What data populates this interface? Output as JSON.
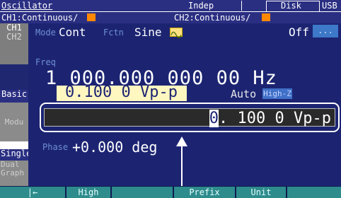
{
  "status": {
    "title": "Oscillator",
    "mode_tag": "Indep",
    "disk": "Disk",
    "usb": "USB",
    "ch1_status": "CH1:Continuous/",
    "ch2_status": "CH2:Continuous/",
    "status_color": "#ff8800"
  },
  "tabs": {
    "ch_active": "CH1",
    "ch_inactive": "CH2",
    "basic": "Basic",
    "modu": "Modu",
    "single": "Single",
    "dual_graph": [
      "Dual",
      "Graph"
    ]
  },
  "params": {
    "mode_label": "Mode",
    "mode_value": "Cont",
    "fctn_label": "Fctn",
    "fctn_value": "Sine",
    "waveform_icon": "sine-wave-icon",
    "output": "Off",
    "more": "...",
    "freq_label": "Freq",
    "freq_value": "1 000.000 000 00 Hz",
    "amp_value": "0.100 0 Vp-p",
    "auto_label": "Auto",
    "load_badge": "High-Z",
    "phase_label": "Phase",
    "phase_value": "+0.000 deg"
  },
  "edit": {
    "cursor_digit": "0",
    "rest": ". 100 0 Vp-p"
  },
  "softkeys": [
    "|←",
    "High",
    "",
    "Prefix",
    "Unit",
    ""
  ],
  "colors": {
    "panel": "#1c2472",
    "topbar": "#2a2f82",
    "softkey": "#2e8c8c"
  }
}
